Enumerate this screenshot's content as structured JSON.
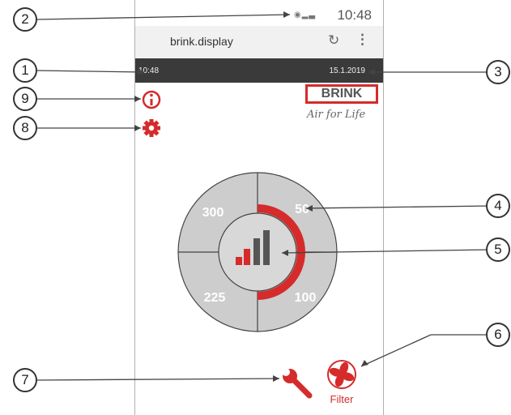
{
  "status_bar": {
    "time": "10:48"
  },
  "browser": {
    "url": "brink.display"
  },
  "app_bar": {
    "time": "10:48",
    "date": "15.1.2019"
  },
  "logo": {
    "brand": "BRINK",
    "tagline": "Air for Life"
  },
  "dial": {
    "segments": [
      {
        "label": "300"
      },
      {
        "label": "50"
      },
      {
        "label": "225"
      },
      {
        "label": "100"
      }
    ]
  },
  "filter": {
    "label": "Filter"
  },
  "annotations": [
    "1",
    "2",
    "3",
    "4",
    "5",
    "6",
    "7",
    "8",
    "9"
  ],
  "colors": {
    "accent": "#d52b2b",
    "dial_gray": "#cdcdcd",
    "header": "#3a3a3a"
  },
  "icons": {
    "info": "info-icon",
    "settings": "gear-icon",
    "service": "wrench-icon",
    "filter": "fan-icon",
    "level": "bar-level-icon"
  }
}
